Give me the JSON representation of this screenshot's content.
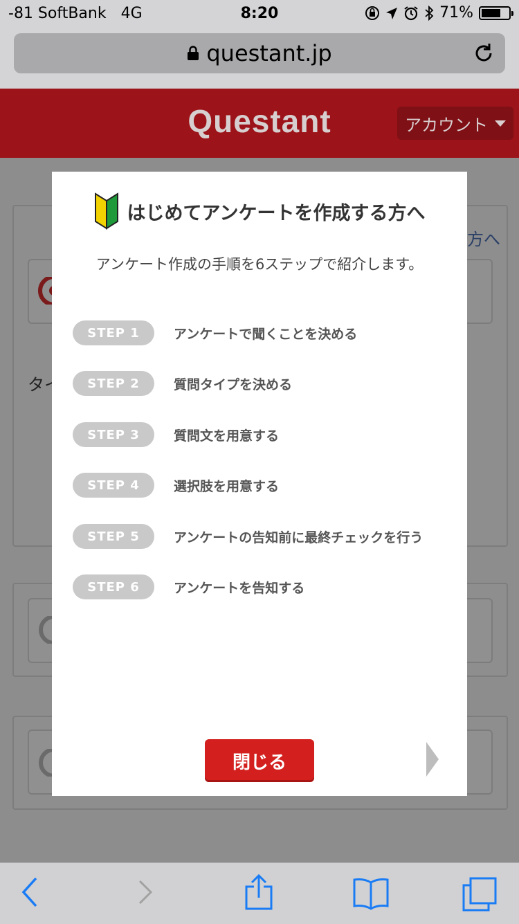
{
  "status_bar": {
    "carrier": "-81 SoftBank",
    "network": "4G",
    "time": "8:20",
    "battery": "71%",
    "battery_level": 0.71
  },
  "browser": {
    "url": "questant.jp"
  },
  "site": {
    "logo": "Questant",
    "account_label": "アカウント"
  },
  "background": {
    "partial_link": "方へ",
    "partial_text": "タイ"
  },
  "modal": {
    "title": "はじめてアンケートを作成する方へ",
    "subtitle": "アンケート作成の手順を6ステップで紹介します。",
    "steps": [
      {
        "badge": "STEP 1",
        "text": "アンケートで聞くことを決める"
      },
      {
        "badge": "STEP 2",
        "text": "質問タイプを決める"
      },
      {
        "badge": "STEP 3",
        "text": "質問文を用意する"
      },
      {
        "badge": "STEP 4",
        "text": "選択肢を用意する"
      },
      {
        "badge": "STEP 5",
        "text": "アンケートの告知前に最終チェックを行う"
      },
      {
        "badge": "STEP 6",
        "text": "アンケートを告知する"
      }
    ],
    "close_label": "閉じる"
  },
  "colors": {
    "brand_red": "#d3201f",
    "header_red": "#9c1319",
    "ios_blue": "#1a7cf5"
  }
}
